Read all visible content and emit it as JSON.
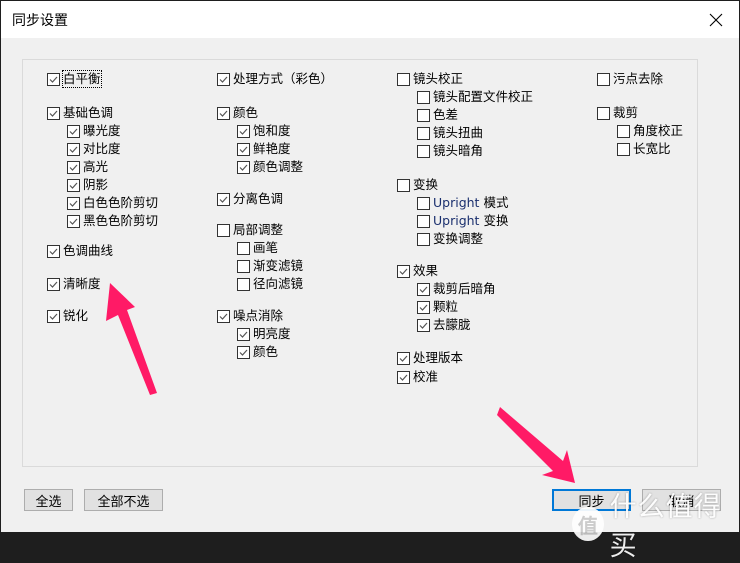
{
  "window": {
    "title": "同步设置",
    "close_icon": "close-icon"
  },
  "columns": [
    {
      "groups": [
        {
          "label": "白平衡",
          "checked": true,
          "focused": true,
          "children": []
        },
        {
          "label": "基础色调",
          "checked": true,
          "children": [
            {
              "label": "曝光度",
              "checked": true
            },
            {
              "label": "对比度",
              "checked": true
            },
            {
              "label": "高光",
              "checked": true
            },
            {
              "label": "阴影",
              "checked": true
            },
            {
              "label": "白色色阶剪切",
              "checked": true
            },
            {
              "label": "黑色色阶剪切",
              "checked": true
            }
          ]
        },
        {
          "label": "色调曲线",
          "checked": true,
          "children": []
        },
        {
          "label": "清晰度",
          "checked": true,
          "children": []
        },
        {
          "label": "锐化",
          "checked": true,
          "children": []
        }
      ]
    },
    {
      "groups": [
        {
          "label": "处理方式（彩色）",
          "checked": true,
          "children": []
        },
        {
          "label": "颜色",
          "checked": true,
          "children": [
            {
              "label": "饱和度",
              "checked": true
            },
            {
              "label": "鲜艳度",
              "checked": true
            },
            {
              "label": "颜色调整",
              "checked": true
            }
          ]
        },
        {
          "label": "分离色调",
          "checked": true,
          "children": []
        },
        {
          "label": "局部调整",
          "checked": false,
          "children": [
            {
              "label": "画笔",
              "checked": false
            },
            {
              "label": "渐变滤镜",
              "checked": false
            },
            {
              "label": "径向滤镜",
              "checked": false
            }
          ]
        },
        {
          "label": "噪点消除",
          "checked": true,
          "children": [
            {
              "label": "明亮度",
              "checked": true
            },
            {
              "label": "颜色",
              "checked": true
            }
          ]
        }
      ]
    },
    {
      "groups": [
        {
          "label": "镜头校正",
          "checked": false,
          "children": [
            {
              "label": "镜头配置文件校正",
              "checked": false
            },
            {
              "label": "色差",
              "checked": false
            },
            {
              "label": "镜头扭曲",
              "checked": false
            },
            {
              "label": "镜头暗角",
              "checked": false
            }
          ]
        },
        {
          "label": "变换",
          "checked": false,
          "children": [
            {
              "label": "Upright 模式",
              "checked": false
            },
            {
              "label": "Upright 变换",
              "checked": false
            },
            {
              "label": "变换调整",
              "checked": false
            }
          ]
        },
        {
          "label": "效果",
          "checked": true,
          "children": [
            {
              "label": "裁剪后暗角",
              "checked": true
            },
            {
              "label": "颗粒",
              "checked": true
            },
            {
              "label": "去朦胧",
              "checked": true
            }
          ]
        },
        {
          "label": "处理版本",
          "checked": true,
          "children": []
        },
        {
          "label": "校准",
          "checked": true,
          "children": []
        }
      ]
    },
    {
      "groups": [
        {
          "label": "污点去除",
          "checked": false,
          "children": []
        },
        {
          "label": "裁剪",
          "checked": false,
          "children": [
            {
              "label": "角度校正",
              "checked": false
            },
            {
              "label": "长宽比",
              "checked": false
            }
          ]
        }
      ]
    }
  ],
  "buttons": {
    "select_all": "全选",
    "select_none": "全部不选",
    "sync": "同步",
    "cancel": "取消"
  },
  "annotations": {
    "arrow_color": "#ff1a66"
  },
  "watermark": {
    "logo": "值",
    "text": "什么值得买"
  }
}
